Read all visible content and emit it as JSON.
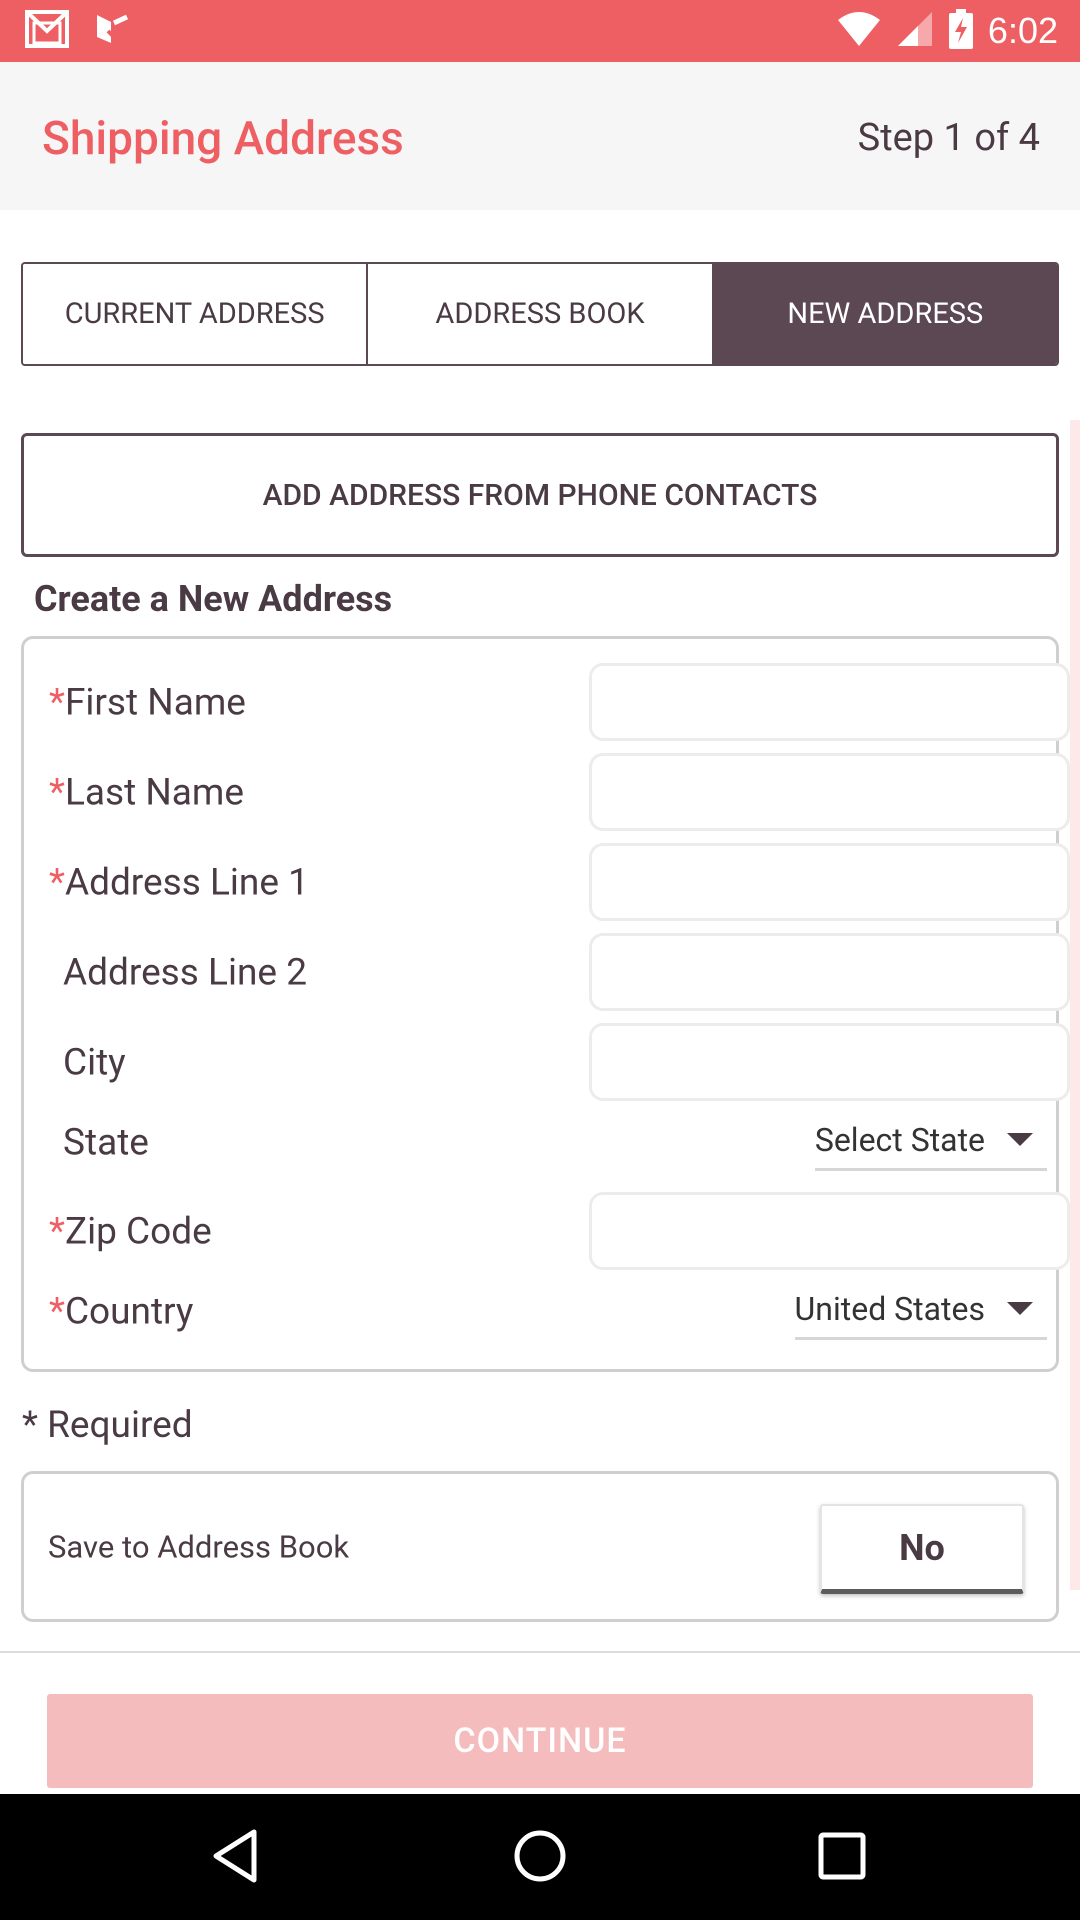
{
  "status_bar": {
    "time": "6:02",
    "icons": [
      "gmail-icon",
      "check-icon",
      "wifi-icon",
      "signal-icon",
      "battery-charging-icon"
    ],
    "color": "#ee5f64"
  },
  "header": {
    "title": "Shipping Address",
    "step": "Step 1 of 4"
  },
  "tabs": [
    {
      "label": "CURRENT ADDRESS",
      "active": false
    },
    {
      "label": "ADDRESS BOOK",
      "active": false
    },
    {
      "label": "NEW ADDRESS",
      "active": true
    }
  ],
  "contacts_button": "ADD ADDRESS FROM PHONE CONTACTS",
  "section_title": "Create a New Address",
  "form": {
    "required_marker": "*",
    "fields": [
      {
        "label": "First Name",
        "required": true,
        "type": "text",
        "value": ""
      },
      {
        "label": "Last Name",
        "required": true,
        "type": "text",
        "value": ""
      },
      {
        "label": "Address Line 1",
        "required": true,
        "type": "text",
        "value": ""
      },
      {
        "label": "Address Line 2",
        "required": false,
        "type": "text",
        "value": ""
      },
      {
        "label": "City",
        "required": false,
        "type": "text",
        "value": ""
      },
      {
        "label": "State",
        "required": false,
        "type": "select",
        "value": "Select State"
      },
      {
        "label": "Zip Code",
        "required": true,
        "type": "text",
        "value": ""
      },
      {
        "label": "Country",
        "required": true,
        "type": "select",
        "value": "United States"
      }
    ]
  },
  "required_note": "* Required",
  "save_to_book": {
    "label": "Save to Address Book",
    "value": "No"
  },
  "continue_label": "CONTINUE",
  "colors": {
    "accent": "#ee5f64",
    "dark": "#5b4852",
    "continue_disabled": "#f5bcbe"
  }
}
